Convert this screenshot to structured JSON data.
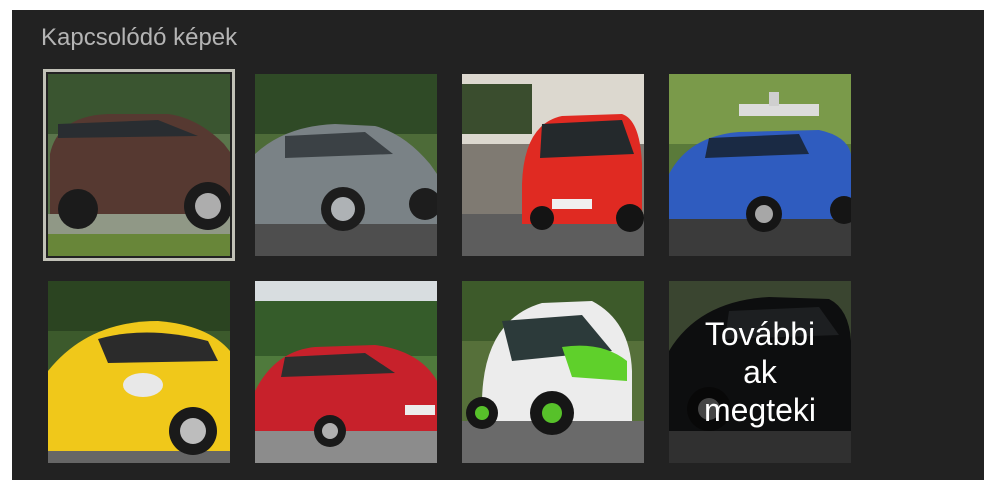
{
  "panel": {
    "title": "Kapcsolódó képek",
    "background": "#222222",
    "title_color": "#b4b4b4"
  },
  "thumbnails": [
    {
      "subject": "brown-station-wagon-photo",
      "selected": true
    },
    {
      "subject": "grey-sedan-photo",
      "selected": false
    },
    {
      "subject": "red-smart-car-photo",
      "selected": false
    },
    {
      "subject": "blue-autonomous-car-photo",
      "selected": false
    },
    {
      "subject": "yellow-sports-car-photo",
      "selected": false
    },
    {
      "subject": "red-lexus-sedan-photo",
      "selected": false
    },
    {
      "subject": "renault-twizy-photo",
      "selected": false
    },
    {
      "subject": "black-sedan-photo",
      "selected": false
    }
  ],
  "more_button": {
    "label": "További ak megteki"
  }
}
